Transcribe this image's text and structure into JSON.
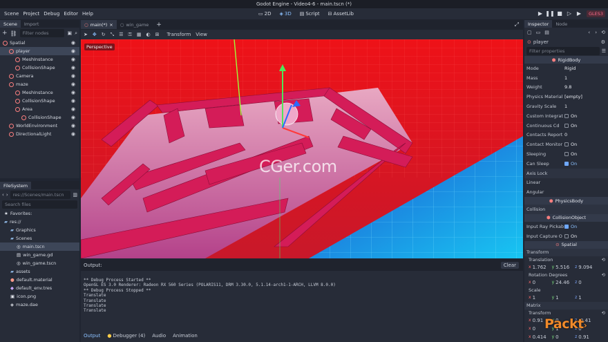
{
  "window_title": "Godot Engine - Video4-6 - main.tscn (*)",
  "menu": [
    "Scene",
    "Project",
    "Debug",
    "Editor",
    "Help"
  ],
  "workspaces": [
    {
      "label": "2D",
      "icon": "2d-icon"
    },
    {
      "label": "3D",
      "icon": "3d-icon"
    },
    {
      "label": "Script",
      "icon": "script-icon"
    },
    {
      "label": "AssetLib",
      "icon": "assetlib-icon"
    }
  ],
  "renderer": "GLES3",
  "scene_dock": {
    "tabs": [
      "Scene",
      "Import"
    ],
    "filter_placeholder": "Filter nodes",
    "nodes": [
      {
        "label": "Spatial",
        "depth": 0,
        "color": "#fc7f7f"
      },
      {
        "label": "player",
        "depth": 1,
        "color": "#fc7f7f",
        "selected": true
      },
      {
        "label": "MeshInstance",
        "depth": 2,
        "color": "#fc7f7f"
      },
      {
        "label": "CollisionShape",
        "depth": 2,
        "color": "#fc7f7f"
      },
      {
        "label": "Camera",
        "depth": 1,
        "color": "#fc7f7f"
      },
      {
        "label": "maze",
        "depth": 1,
        "color": "#fc7f7f"
      },
      {
        "label": "MeshInstance",
        "depth": 2,
        "color": "#fc7f7f"
      },
      {
        "label": "CollisionShape",
        "depth": 2,
        "color": "#fc7f7f"
      },
      {
        "label": "Area",
        "depth": 2,
        "color": "#fc7f7f"
      },
      {
        "label": "CollisionShape",
        "depth": 3,
        "color": "#fc7f7f"
      },
      {
        "label": "WorldEnvironment",
        "depth": 1,
        "color": "#fc7f7f"
      },
      {
        "label": "DirectionalLight",
        "depth": 1,
        "color": "#fc7f7f"
      }
    ]
  },
  "filesystem": {
    "tab": "FileSystem",
    "path": "res://Scenes/main.tscn",
    "search_placeholder": "Search files",
    "items": [
      {
        "label": "Favorites:",
        "depth": 0,
        "icon": "star-icon"
      },
      {
        "label": "res://",
        "depth": 0,
        "icon": "folder-icon"
      },
      {
        "label": "Graphics",
        "depth": 1,
        "icon": "folder-icon"
      },
      {
        "label": "Scenes",
        "depth": 1,
        "icon": "folder-icon"
      },
      {
        "label": "main.tscn",
        "depth": 2,
        "icon": "scene-icon",
        "selected": true
      },
      {
        "label": "win_game.gd",
        "depth": 2,
        "icon": "script-icon"
      },
      {
        "label": "win_game.tscn",
        "depth": 2,
        "icon": "scene-icon"
      },
      {
        "label": "assets",
        "depth": 1,
        "icon": "folder-icon"
      },
      {
        "label": "default.material",
        "depth": 1,
        "icon": "material-icon"
      },
      {
        "label": "default_env.tres",
        "depth": 1,
        "icon": "resource-icon"
      },
      {
        "label": "icon.png",
        "depth": 1,
        "icon": "image-icon"
      },
      {
        "label": "maze.dae",
        "depth": 1,
        "icon": "mesh-icon"
      }
    ]
  },
  "editor_tabs": [
    "main(*)",
    "win_game"
  ],
  "viewport_toolbar": {
    "transform": "Transform",
    "view": "View"
  },
  "viewport_label": "Perspective",
  "watermark": "CGer.com",
  "output": {
    "title": "Output:",
    "clear": "Clear",
    "lines": [
      "** Debug Process Started **",
      "OpenGL ES 3.0 Renderer: Radeon RX 560 Series (POLARIS11, DRM 3.30.0, 5.1.14-arch1-1-ARCH, LLVM 8.0.0)",
      "** Debug Process Stopped **",
      "Translate",
      "Translate",
      "Translate",
      "Translate"
    ],
    "bottom_tabs": [
      "Output",
      "Debugger (4)",
      "Audio",
      "Animation"
    ]
  },
  "inspector": {
    "tabs": [
      "Inspector",
      "Node"
    ],
    "node_name": "player",
    "filter_placeholder": "Filter properties",
    "rigidbody_header": "RigidBody",
    "props": [
      {
        "label": "Mode",
        "value": "Rigid"
      },
      {
        "label": "Mass",
        "value": "1"
      },
      {
        "label": "Weight",
        "value": "9.8"
      },
      {
        "label": "Physics Material",
        "value": "[empty]"
      },
      {
        "label": "Gravity Scale",
        "value": "1"
      },
      {
        "label": "Custom Integrat",
        "value": "On",
        "check": false
      },
      {
        "label": "Continuous Cd",
        "value": "On",
        "check": false
      },
      {
        "label": "Contacts Report",
        "value": "0"
      },
      {
        "label": "Contact Monitor",
        "value": "On",
        "check": false
      },
      {
        "label": "Sleeping",
        "value": "On",
        "check": false
      },
      {
        "label": "Can Sleep",
        "value": "On",
        "check": true
      }
    ],
    "groups": [
      "Axis Lock",
      "Linear",
      "Angular"
    ],
    "physicsbody_header": "PhysicsBody",
    "collision_label": "Collision",
    "collisionobject_header": "CollisionObject",
    "input_ray_pickable": {
      "label": "Input Ray Pickab",
      "value": "On",
      "check": true
    },
    "input_capture": {
      "label": "Input Capture O",
      "value": "On",
      "check": false
    },
    "spatial_header": "Spatial",
    "transform_label": "Transform",
    "translation": {
      "label": "Translation",
      "x": "1.762",
      "y": "5.516",
      "z": "9.094"
    },
    "rotation": {
      "label": "Rotation Degrees",
      "x": "0",
      "y": "24.46",
      "z": "0"
    },
    "scale": {
      "label": "Scale",
      "x": "1",
      "y": "1",
      "z": "1"
    },
    "matrix_label": "Matrix",
    "matrix_transform_label": "Transform",
    "matrix_row1": {
      "x": "0.91",
      "y": "0",
      "z": "-0.41"
    },
    "matrix_row2": {
      "x": "0",
      "y": "1",
      "z": "0"
    },
    "matrix_row3": {
      "x": "0.414",
      "y": "0",
      "z": "0.91"
    }
  },
  "brand_logo": "Packt"
}
